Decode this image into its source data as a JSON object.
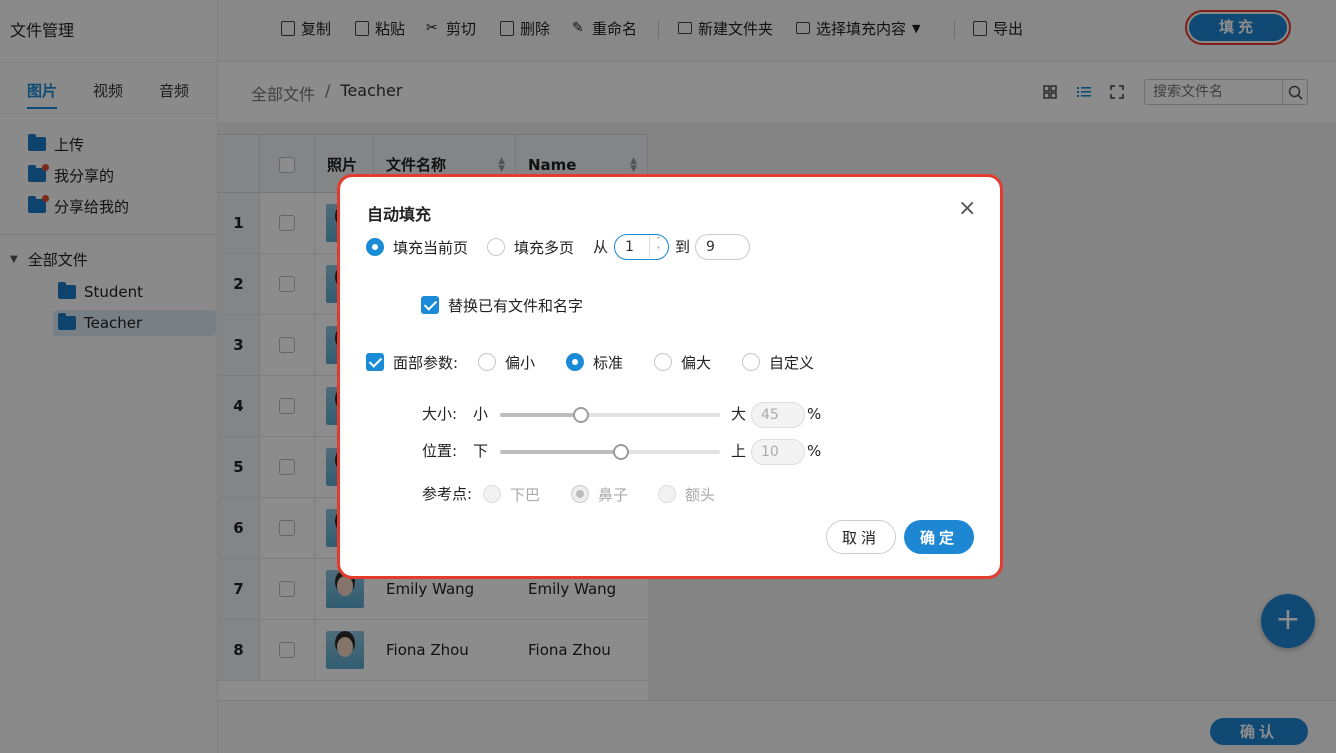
{
  "app": {
    "title": "文件管理"
  },
  "sidebar": {
    "tabs": [
      {
        "label": "图片",
        "active": true
      },
      {
        "label": "视频",
        "active": false
      },
      {
        "label": "音频",
        "active": false
      }
    ],
    "quick": [
      {
        "label": "上传"
      },
      {
        "label": "我分享的"
      },
      {
        "label": "分享给我的"
      }
    ],
    "tree": {
      "root": "全部文件",
      "children": [
        {
          "label": "Student",
          "active": false
        },
        {
          "label": "Teacher",
          "active": true
        }
      ]
    }
  },
  "toolbar": {
    "copy": "复制",
    "paste": "粘贴",
    "cut": "剪切",
    "delete": "删除",
    "rename": "重命名",
    "new_folder": "新建文件夹",
    "select_fill": "选择填充内容",
    "export": "导出",
    "fill": "填充"
  },
  "breadcrumb": {
    "root": "全部文件",
    "sep": "/",
    "current": "Teacher"
  },
  "search": {
    "placeholder": "搜索文件名"
  },
  "table": {
    "headers": {
      "photo": "照片",
      "filename": "文件名称",
      "name": "Name"
    },
    "rows": [
      {
        "num": "1",
        "filename": "",
        "name": ""
      },
      {
        "num": "2",
        "filename": "",
        "name": ""
      },
      {
        "num": "3",
        "filename": "",
        "name": ""
      },
      {
        "num": "4",
        "filename": "",
        "name": ""
      },
      {
        "num": "5",
        "filename": "",
        "name": ""
      },
      {
        "num": "6",
        "filename": "",
        "name": ""
      },
      {
        "num": "7",
        "filename": "Emily Wang",
        "name": "Emily Wang"
      },
      {
        "num": "8",
        "filename": "Fiona Zhou",
        "name": "Fiona Zhou"
      }
    ]
  },
  "footer": {
    "confirm": "确认",
    "fab": "+"
  },
  "dialog": {
    "title": "自动填充",
    "close": "×",
    "fill_current": "填充当前页",
    "fill_multi": "填充多页",
    "from": "从",
    "from_value": "1",
    "to": "到",
    "to_value": "9",
    "replace_existing": "替换已有文件和名字",
    "face_params": "面部参数:",
    "presets": [
      "偏小",
      "标准",
      "偏大",
      "自定义"
    ],
    "selected_preset": "标准",
    "size_label": "大小:",
    "size_min": "小",
    "size_max": "大",
    "size_value": "45",
    "size_percent": 0.37,
    "pos_label": "位置:",
    "pos_min": "下",
    "pos_max": "上",
    "pos_value": "10",
    "pos_percent": 0.55,
    "percent_sign": "%",
    "ref_label": "参考点:",
    "ref_options": [
      "下巴",
      "鼻子",
      "额头"
    ],
    "selected_ref": "鼻子",
    "cancel": "取消",
    "ok": "确定"
  }
}
